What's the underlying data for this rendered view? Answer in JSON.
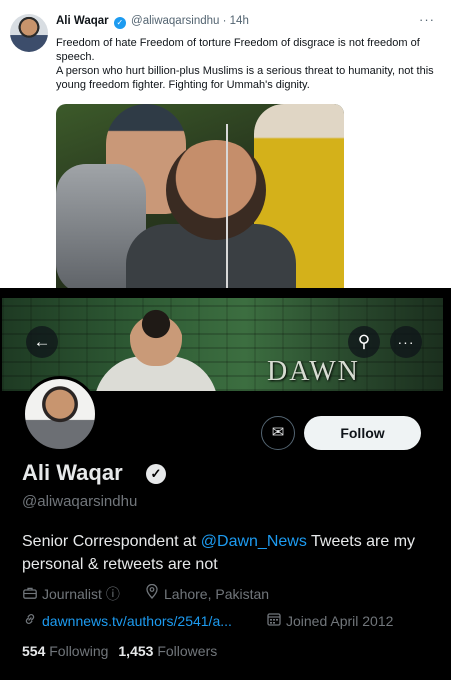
{
  "tweet": {
    "name": "Ali Waqar",
    "handle": "@aliwaqarsindhu",
    "separator": "·",
    "time": "14h",
    "more_icon": "···",
    "text_line1": "Freedom of hate Freedom of torture Freedom of disgrace is not freedom of speech.",
    "text_line2": "A person who hurt billion-plus Muslims is a serious threat to humanity, not this young freedom fighter. Fighting for Ummah's dignity."
  },
  "profile": {
    "banner_logo": "DAWN",
    "back_icon": "←",
    "search_icon": "⚲",
    "more_icon": "···",
    "mail_icon": "✉",
    "follow_label": "Follow",
    "name": "Ali Waqar",
    "verified_icon": "✓",
    "handle": "@aliwaqarsindhu",
    "bio_before": "Senior Correspondent at ",
    "bio_mention": "@Dawn_News",
    "bio_after": " Tweets are my personal & retweets are not",
    "category": "Journalist",
    "category_info_icon": "ⓘ",
    "location": "Lahore, Pakistan",
    "link": "dawnnews.tv/authors/2541/a...",
    "joined": "Joined April 2012",
    "following_count": "554",
    "following_label": "Following",
    "followers_count": "1,453",
    "followers_label": "Followers"
  },
  "colors": {
    "accent": "#1d9bf0",
    "muted": "#71767b",
    "follow_bg": "#eff3f4"
  }
}
